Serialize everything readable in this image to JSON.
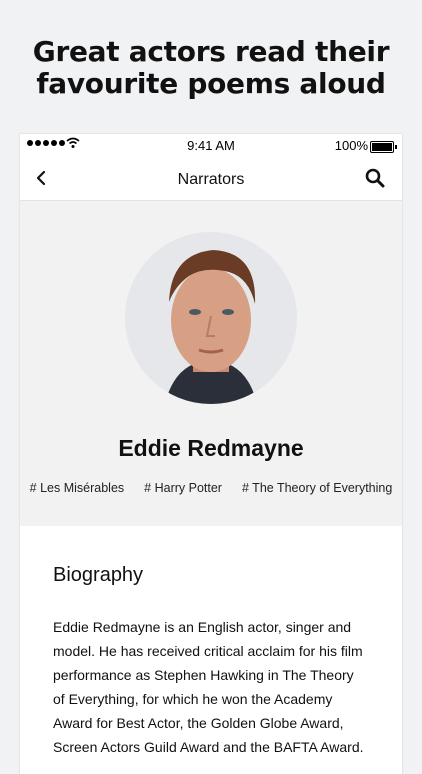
{
  "promo": {
    "title_line1": "Great actors read their",
    "title_line2": "favourite poems aloud"
  },
  "status_bar": {
    "time": "9:41 AM",
    "battery": "100%"
  },
  "nav": {
    "title": "Narrators",
    "back_icon": "chevron-left-icon",
    "search_icon": "search-icon"
  },
  "profile": {
    "name": "Eddie Redmayne",
    "tags": [
      "# Les Misérables",
      "# Harry Potter",
      "# The Theory of Everything"
    ]
  },
  "biography": {
    "heading": "Biography",
    "text": "Eddie Redmayne is an English actor, singer and model. He has received critical acclaim for his film performance as Stephen Hawking in The Theory of Everything, for which he won the Academy Award for Best Actor, the Golden Globe Award, Screen Actors Guild Award and the BAFTA Award."
  }
}
